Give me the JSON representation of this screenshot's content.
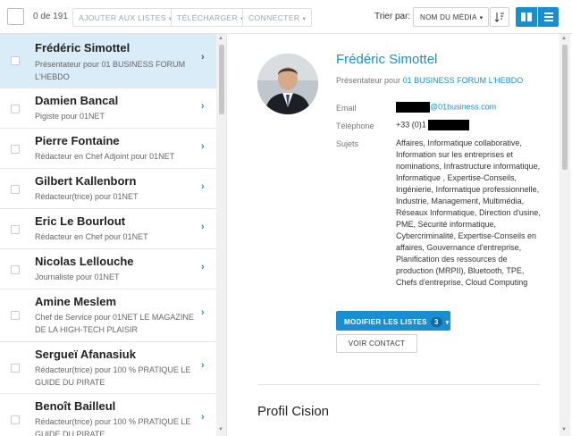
{
  "toolbar": {
    "count": "0 de 191",
    "add_to_lists": "AJOUTER AUX LISTES",
    "download": "TÉLÉCHARGER",
    "connect": "CONNECTER",
    "sort_label": "Trier par:",
    "sort_value": "NOM DU MÉDIA",
    "accent": "#1a8fd0"
  },
  "contacts": [
    {
      "name": "Frédéric Simottel",
      "desc": "Présentateur pour 01 BUSINESS FORUM L'HEBDO",
      "selected": true
    },
    {
      "name": "Damien Bancal",
      "desc": "Pigiste pour 01NET"
    },
    {
      "name": "Pierre Fontaine",
      "desc": "Rédacteur en Chef Adjoint pour 01NET"
    },
    {
      "name": "Gilbert Kallenborn",
      "desc": "Rédacteur(trice) pour 01NET"
    },
    {
      "name": "Eric Le Bourlout",
      "desc": "Rédacteur en Chef pour 01NET"
    },
    {
      "name": "Nicolas Lellouche",
      "desc": "Journaliste pour 01NET"
    },
    {
      "name": "Amine Meslem",
      "desc": "Chef de Service pour 01NET LE MAGAZINE DE LA HIGH-TECH PLAISIR"
    },
    {
      "name": "Sergueï Afanasiuk",
      "desc": "Rédacteur(trice) pour 100 % PRATIQUE LE GUIDE DU PIRATE"
    },
    {
      "name": "Benoît Bailleul",
      "desc": "Rédacteur(trice) pour 100 % PRATIQUE LE GUIDE DU PIRATE"
    }
  ],
  "detail": {
    "name": "Frédéric Simottel",
    "role_prefix": "Présentateur pour",
    "organization": "01 BUSINESS FORUM L'HEBDO",
    "email_label": "Email",
    "email_domain": "@01business.com",
    "phone_label": "Téléphone",
    "phone_prefix": "+33 (0)1",
    "subjects_label": "Sujets",
    "subjects": "Affaires, Informatique collaborative, Information sur les entreprises et nominations, Infrastructure informatique, Informatique  , Expertise-Conseils, Ingénierie, Informatique professionnelle, Industrie, Management, Multimédia, Réseaux Informatique, Direction d'usine, PME, Sécurité informatique, Cybercriminalité, Expertise-Conseils en affaires, Gouvernance d'entreprise, Planification des ressources de production (MRPII), Bluetooth, TPE, Chefs d'entreprise, Cloud Computing",
    "modify_lists": "MODIFIER LES LISTES",
    "lists_count": "3",
    "view_contact": "VOIR CONTACT",
    "section_title": "Profil Cision"
  }
}
